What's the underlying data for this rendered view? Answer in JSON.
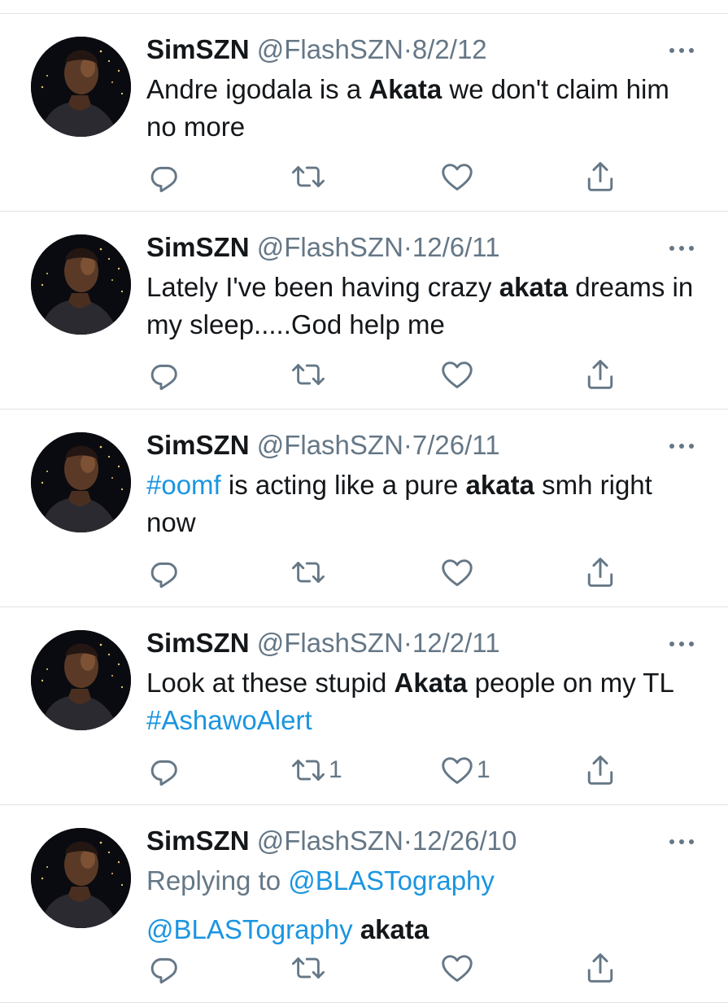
{
  "tweets": [
    {
      "name": "SimSZN",
      "handle": "@FlashSZN",
      "separator": "·",
      "date": "8/2/12",
      "text_before": "Andre igodala is a ",
      "keyword": "Akata",
      "text_after": " we don't claim him no more",
      "retweet_count": "",
      "like_count": ""
    },
    {
      "name": "SimSZN",
      "handle": "@FlashSZN",
      "separator": "·",
      "date": "12/6/11",
      "text_before": "Lately I've been having crazy ",
      "keyword": "akata",
      "text_after": " dreams in my sleep.....God help me",
      "retweet_count": "",
      "like_count": ""
    },
    {
      "name": "SimSZN",
      "handle": "@FlashSZN",
      "separator": "·",
      "date": "7/26/11",
      "hashtag": "#oomf",
      "text_before": " is acting like a pure ",
      "keyword": "akata",
      "text_after": " smh right now",
      "retweet_count": "",
      "like_count": ""
    },
    {
      "name": "SimSZN",
      "handle": "@FlashSZN",
      "separator": "·",
      "date": "12/2/11",
      "text_before": "Look at these stupid ",
      "keyword": "Akata",
      "text_after": " people on my TL ",
      "hashtag": "#AshawoAlert",
      "retweet_count": "1",
      "like_count": "1"
    },
    {
      "name": "SimSZN",
      "handle": "@FlashSZN",
      "separator": "·",
      "date": "12/26/10",
      "replying_label": "Replying to ",
      "replying_to": "@BLASTography",
      "mention": "@BLASTography",
      "keyword": "akata",
      "retweet_count": "",
      "like_count": ""
    }
  ],
  "icons": {
    "reply": "reply-icon",
    "retweet": "retweet-icon",
    "like": "heart-icon",
    "share": "share-icon",
    "more": "more-icon"
  },
  "colors": {
    "text": "#14171a",
    "secondary": "#657786",
    "link": "#1b95e0",
    "divider": "#dfe3e7"
  }
}
